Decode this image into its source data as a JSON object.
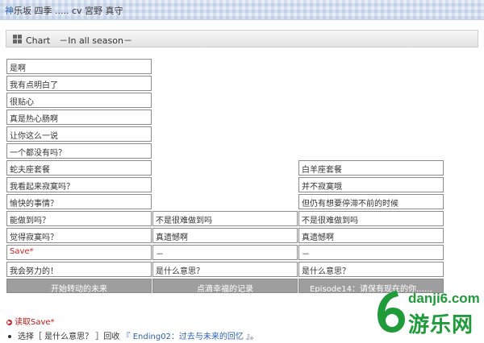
{
  "window": {
    "title_first": "神",
    "title_rest": "乐坂 四季 ..... cv 宮野 真守"
  },
  "header": {
    "label": "Chart　－In all season－"
  },
  "col1": [
    {
      "text": "是啊"
    },
    {
      "text": "我有点明白了"
    },
    {
      "text": "很贴心"
    },
    {
      "text": "真是热心肠啊"
    },
    {
      "text": "让你这么一说"
    },
    {
      "text": "一个都没有吗？"
    },
    {
      "text": "蛇夫座套餐"
    },
    {
      "text": "我看起来寂寞吗？"
    },
    {
      "text": "愉快的事情？"
    },
    {
      "text": "能做到吗？"
    },
    {
      "text": "觉得寂寞吗？"
    },
    {
      "text": "Save*",
      "color": "#d42020"
    },
    {
      "text": "我会努力的！"
    }
  ],
  "col2": [
    {
      "text": "不是很难做到吗"
    },
    {
      "text": "真遗憾啊"
    },
    {
      "text": "－"
    },
    {
      "text": "是什么意思？"
    }
  ],
  "col3": [
    {
      "text": "白羊座套餐"
    },
    {
      "text": "并不寂寞哦"
    },
    {
      "text": "但仍有想要停滞不前的时候"
    },
    {
      "text": "不是很难做到吗"
    },
    {
      "text": "真遗憾啊"
    },
    {
      "text": "－"
    },
    {
      "text": "是什么意思？"
    }
  ],
  "footers": [
    {
      "text": "开始转动的未来"
    },
    {
      "text": "点滴幸福的记录"
    },
    {
      "text": "Episode14：请保有现在的你……"
    }
  ],
  "load_save": {
    "text": "读取Save*"
  },
  "choice": {
    "prefix": "选择［ 是什么意思？ ］回收 ",
    "link": "『 Ending02：过去与未来的回忆 』",
    "suffix": "。"
  },
  "watermark": {
    "url": "danji6.com",
    "name": "游乐网",
    "brand_color": "#1f9b3a"
  },
  "colors": {
    "accent_blue": "#2a62b8",
    "save_red": "#d42020",
    "footer_gray": "#9e9e9e"
  }
}
